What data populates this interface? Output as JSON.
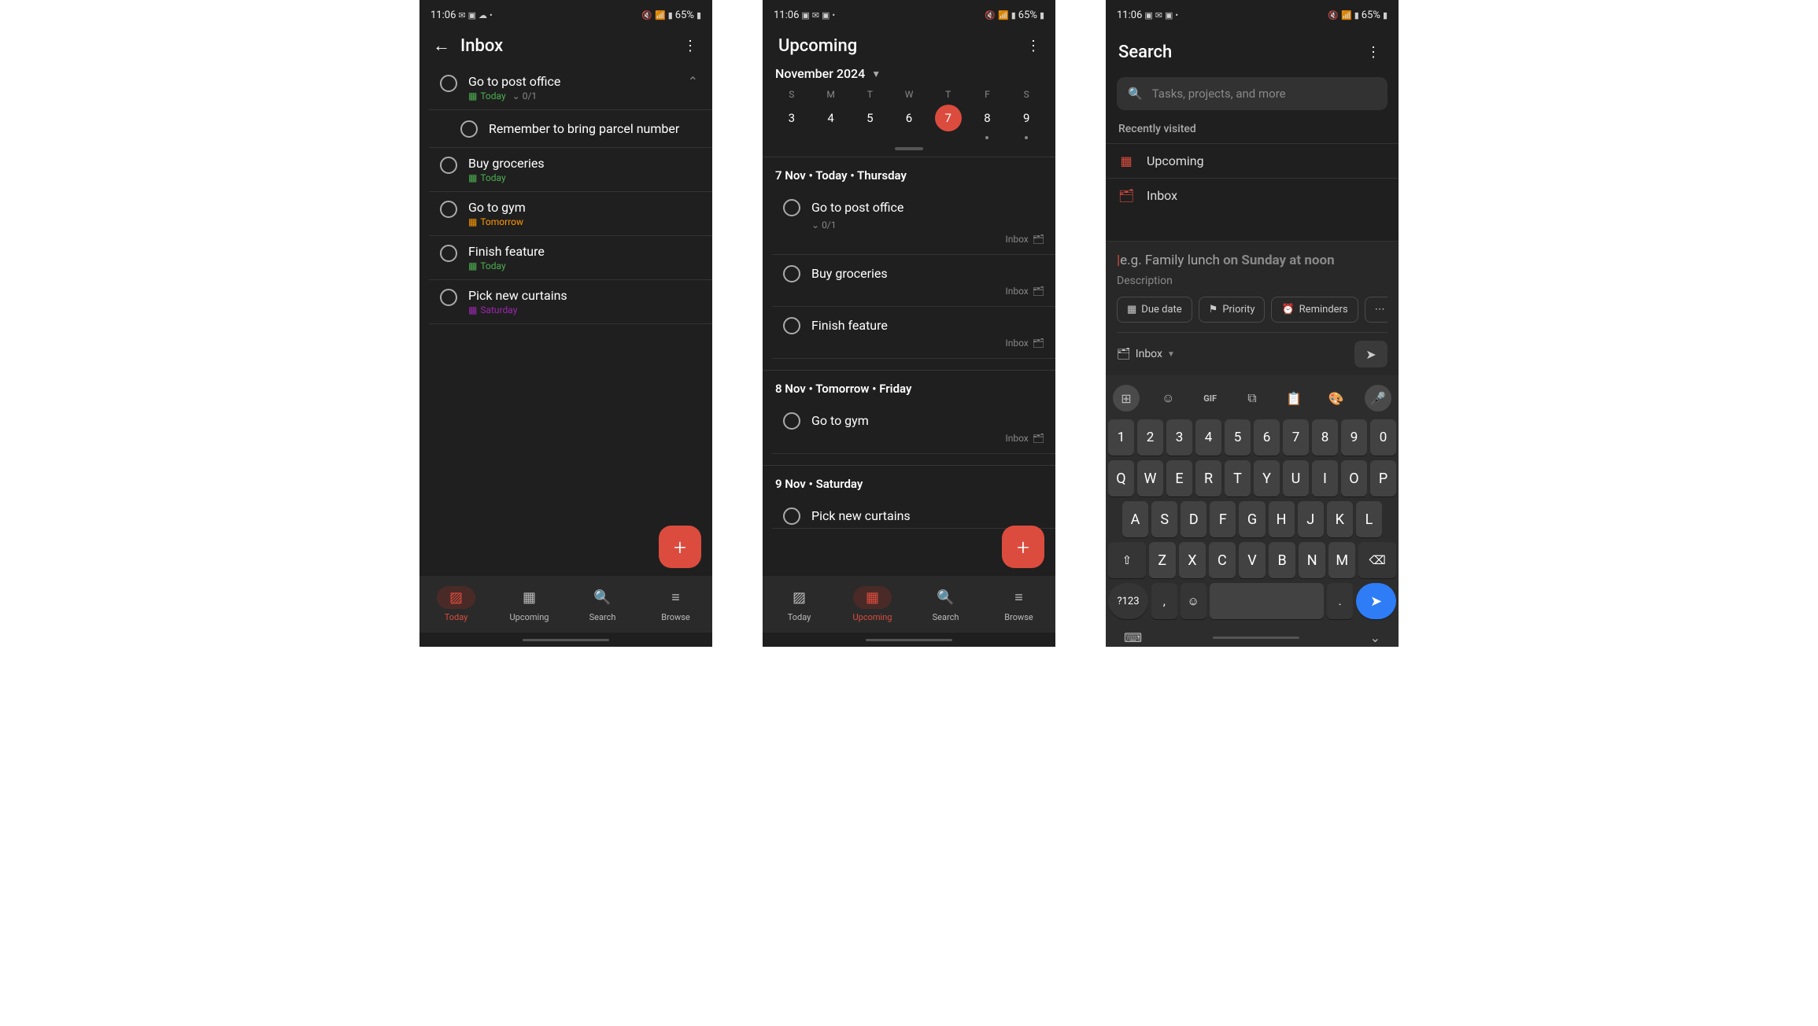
{
  "status": {
    "time": "11:06",
    "battery": "65%"
  },
  "screen1": {
    "title": "Inbox",
    "tasks": [
      {
        "title": "Go to post office",
        "date_label": "Today",
        "date_type": "today",
        "subtask_count": "0/1",
        "subtasks": [
          {
            "title": "Remember to bring parcel number"
          }
        ],
        "expanded": true
      },
      {
        "title": "Buy groceries",
        "date_label": "Today",
        "date_type": "today"
      },
      {
        "title": "Go to gym",
        "date_label": "Tomorrow",
        "date_type": "tomorrow"
      },
      {
        "title": "Finish feature",
        "date_label": "Today",
        "date_type": "today"
      },
      {
        "title": "Pick new curtains",
        "date_label": "Saturday",
        "date_type": "saturday"
      }
    ],
    "nav": {
      "today": "Today",
      "upcoming": "Upcoming",
      "search": "Search",
      "browse": "Browse"
    }
  },
  "screen2": {
    "title": "Upcoming",
    "month": "November 2024",
    "calendar": {
      "daynames": [
        "S",
        "M",
        "T",
        "W",
        "T",
        "F",
        "S"
      ],
      "daynums": [
        "3",
        "4",
        "5",
        "6",
        "7",
        "8",
        "9"
      ],
      "selected": "7",
      "dots": [
        false,
        false,
        false,
        false,
        false,
        true,
        true
      ]
    },
    "sections": [
      {
        "header": "7 Nov • Today • Thursday",
        "tasks": [
          {
            "title": "Go to post office",
            "count": "0/1",
            "project": "Inbox"
          },
          {
            "title": "Buy groceries",
            "project": "Inbox"
          },
          {
            "title": "Finish feature",
            "project": "Inbox"
          }
        ]
      },
      {
        "header": "8 Nov • Tomorrow • Friday",
        "tasks": [
          {
            "title": "Go to gym",
            "project": "Inbox"
          }
        ]
      },
      {
        "header": "9 Nov • Saturday",
        "tasks": [
          {
            "title": "Pick new curtains",
            "project": "Inbox"
          }
        ]
      }
    ],
    "nav": {
      "today": "Today",
      "upcoming": "Upcoming",
      "search": "Search",
      "browse": "Browse"
    }
  },
  "screen3": {
    "title": "Search",
    "search_placeholder": "Tasks, projects, and more",
    "recent_header": "Recently visited",
    "recent": [
      {
        "type": "upcoming",
        "label": "Upcoming"
      },
      {
        "type": "inbox",
        "label": "Inbox"
      }
    ],
    "sheet": {
      "input_prefix": "e.g. Family lunch ",
      "input_bold": "on Sunday at noon",
      "description": "Description",
      "chips": {
        "due": "Due date",
        "priority": "Priority",
        "reminders": "Reminders"
      },
      "project": "Inbox"
    },
    "keyboard": {
      "nums": [
        "1",
        "2",
        "3",
        "4",
        "5",
        "6",
        "7",
        "8",
        "9",
        "0"
      ],
      "row1": [
        "Q",
        "W",
        "E",
        "R",
        "T",
        "Y",
        "U",
        "I",
        "O",
        "P"
      ],
      "row2": [
        "A",
        "S",
        "D",
        "F",
        "G",
        "H",
        "J",
        "K",
        "L"
      ],
      "row3": [
        "Z",
        "X",
        "C",
        "V",
        "B",
        "N",
        "M"
      ],
      "sym": "?123",
      "comma": ",",
      "period": "."
    }
  }
}
